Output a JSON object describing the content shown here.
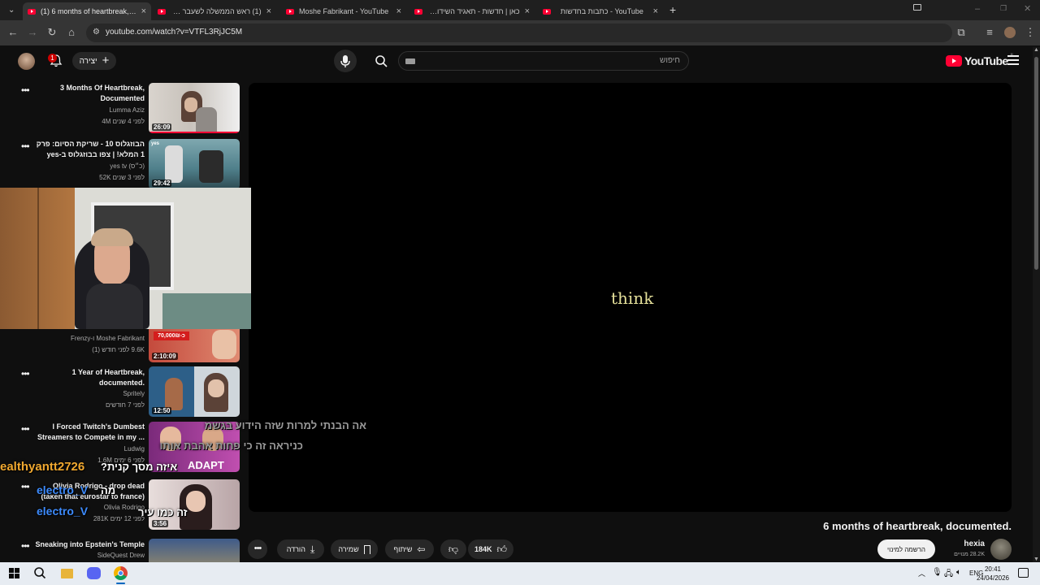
{
  "browser": {
    "tabs": [
      {
        "title": "(1) 6 months of heartbreak, docu",
        "active": true
      },
      {
        "title": "(1) ראש הממשלה לשעבר אהוד",
        "active": false
      },
      {
        "title": "Moshe Fabrikant - YouTube",
        "active": false
      },
      {
        "title": "כאן | חדשות - תאגיד השידור הי",
        "active": false
      },
      {
        "title": "YouTube - כתבות בחדשות",
        "active": false
      }
    ],
    "url": "youtube.com/watch?v=VTFL3RjJC5M",
    "new_tab": "+"
  },
  "youtube": {
    "logo": "YouTube",
    "logo_region": "IL",
    "search_placeholder": "חיפוש",
    "create_label": "יצירה",
    "notification_count": "1"
  },
  "video": {
    "caption": "think",
    "title": "6 months of heartbreak, documented."
  },
  "channel": {
    "name": "hexia",
    "subscribers": "28.2K מנויים",
    "subscribe_label": "הרשמה למינוי"
  },
  "actions": {
    "likes": "184K",
    "share": "שיתוף",
    "save": "שמירה",
    "download": "הורדה"
  },
  "recommendations": [
    {
      "title": "3 Months Of Heartbreak, Documented",
      "channel": "Lumma Aziz",
      "meta": "4M  לפני 4 שנים",
      "duration": "26:09",
      "color": "#c8c2bb"
    },
    {
      "title": "הבוזגלוס 10 - שריקת הסיום: פרק 1 המלא! | צפו בבוזגלוס ב-yes",
      "channel": "yes tv (כ״ס)",
      "meta": "52K  לפני 3 שנים",
      "duration": "29:42",
      "color": "#5b8d9a"
    },
    {
      "title": "",
      "channel": "Frenzy-ו Moshe Fabrikant",
      "meta": "9.6K  לפני חודש (1)",
      "duration": "2:10:09",
      "color": "#b84a3d"
    },
    {
      "title": "1 Year of Heartbreak, documented.",
      "channel": "Spritely",
      "meta": "לפני 7 חודשים",
      "duration": "12:50",
      "color": "#3c6f96"
    },
    {
      "title": "I Forced Twitch's Dumbest Streamers to Compete in my ...",
      "channel": "Ludwig",
      "meta": "1.6M  לפני 6 ימים",
      "duration": "",
      "color": "#a13a8f"
    },
    {
      "title": "Olivia Rodrigo - drop dead (taken that eurostar to france)",
      "channel": "Olivia Rodrigo",
      "meta": "281K  לפני 12 ימים",
      "duration": "3:56",
      "color": "#d9c9c6"
    },
    {
      "title": "Sneaking into Epstein's Temple",
      "channel": "SideQuest Drew",
      "meta": "",
      "duration": "",
      "color": "#3f5b8a"
    }
  ],
  "thumb_text": {
    "promo": "70,000₪-כ",
    "adapt": "ADAPT"
  },
  "chat": [
    {
      "text": "אה הבנתי למרות שזה הידוע בגשמ",
      "color": "#9a9a9a"
    },
    {
      "text": "כניראה זה כי פחות אהבת אותו",
      "color": "#9a9a9a"
    },
    {
      "text": "ealthyantt2726",
      "color": "#f0a830"
    },
    {
      "text": "?איזה מסך קנית",
      "color": "#ffffff"
    },
    {
      "text": "electro_V",
      "color": "#3d8bfd"
    },
    {
      "text": "מה",
      "color": "#ffffff"
    },
    {
      "text": "electro_V",
      "color": "#3d8bfd"
    },
    {
      "text": "זה כמו עיר",
      "color": "#ffffff"
    }
  ],
  "taskbar": {
    "lang": "ENG",
    "time": "20:41",
    "date": "24/04/2026"
  }
}
